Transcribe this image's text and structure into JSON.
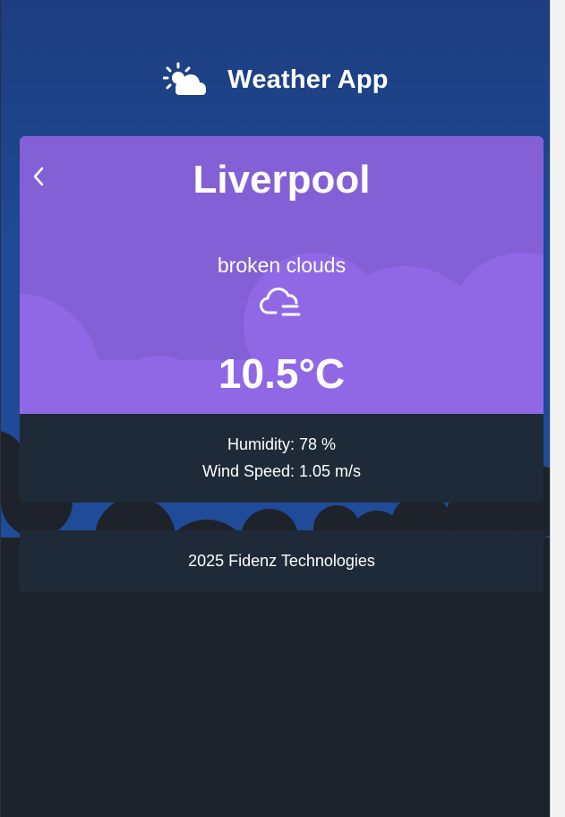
{
  "header": {
    "logo_icon": "partly-sunny-cloud-icon",
    "title": "Weather App"
  },
  "weather": {
    "back_icon": "chevron-left-icon",
    "city": "Liverpool",
    "description": "broken clouds",
    "condition_icon": "cloud-icon",
    "temperature": "10.5°C",
    "humidity": "Humidity: 78 %",
    "wind_speed": "Wind Speed: 1.05 m/s"
  },
  "footer": {
    "text": "2025 Fidenz Technologies"
  },
  "colors": {
    "background": "#1e222b",
    "sky_top": "#1d3f80",
    "card_purple": "#8561d9",
    "card_dark": "#1f2a38",
    "text": "#ffffff"
  }
}
